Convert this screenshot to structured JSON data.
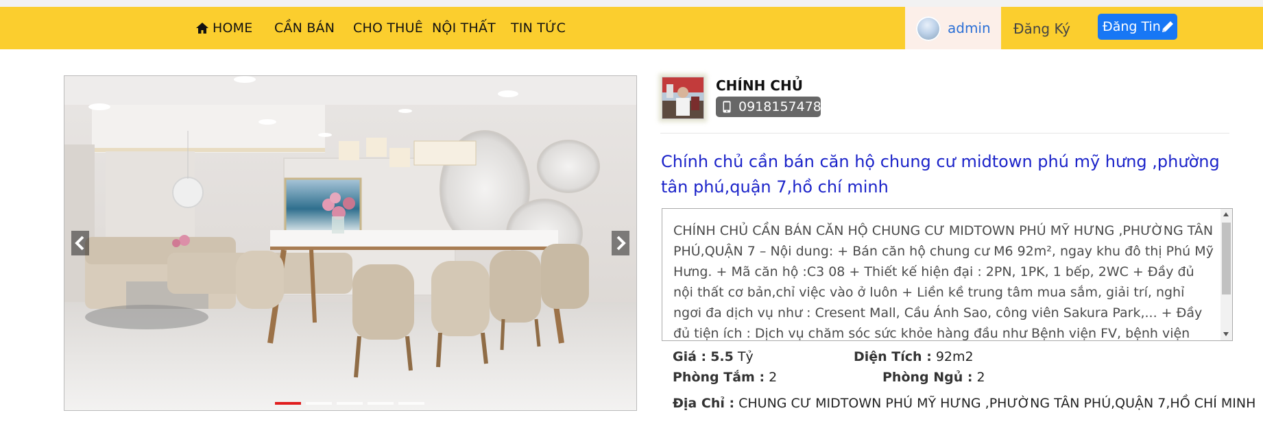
{
  "nav": {
    "items": [
      {
        "label": "HOME",
        "icon": "home-icon"
      },
      {
        "label": "CẦN BÁN"
      },
      {
        "label": "CHO THUÊ"
      },
      {
        "label": "NỘI THẤT"
      },
      {
        "label": "TIN TỨC"
      }
    ],
    "user": {
      "name": "admin"
    },
    "register_label": "Đăng Ký",
    "post_label": "Đăng Tin",
    "bar_color": "#fbce2e",
    "post_button_color": "#1777f5"
  },
  "carousel": {
    "slide_count": 5,
    "active_index": 0
  },
  "owner": {
    "name": "CHÍNH CHỦ",
    "phone": "0918157478"
  },
  "listing": {
    "title": "Chính chủ cần bán căn hộ chung cư midtown phú mỹ hưng ,phường tân phú,quận 7,hồ chí minh",
    "description": "CHÍNH CHỦ CẦN BÁN CĂN HỘ CHUNG CƯ MIDTOWN PHÚ MỸ HƯNG ,PHƯỜNG TÂN PHÚ,QUẬN 7 – Nội dung: + Bán căn hộ chung cư M6 92m², ngay khu đô thị Phú Mỹ Hưng. + Mã căn hộ :C3 08 + Thiết kế hiện đại : 2PN, 1PK, 1 bếp, 2WC + Đầy đủ nội thất cơ bản,chỉ việc vào ở luôn + Liền kề trung tâm mua sắm, giải trí, nghỉ ngơi đa dịch vụ như : Cresent Mall, Cầu Ánh Sao, công viên Sakura Park,... + Đầy đủ tiện ích : Dịch vụ chăm sóc sức khỏe hàng đầu như Bệnh viện FV, bệnh viện Tim Tâm Đức,Chuỗi nhà hàng",
    "price_label": "Giá :",
    "price_value": "5.5",
    "price_unit": "Tỷ",
    "area_label": "Diện Tích :",
    "area_value": "92m2",
    "bath_label": "Phòng Tắm :",
    "bath_value": "2",
    "bed_label": "Phòng Ngủ :",
    "bed_value": "2",
    "address_label": "Địa Chỉ :",
    "address_value": "CHUNG CƯ MIDTOWN PHÚ MỸ HƯNG ,PHƯỜNG TÂN PHÚ,QUẬN 7,HỒ CHÍ MINH",
    "title_color": "#1b23c9"
  }
}
